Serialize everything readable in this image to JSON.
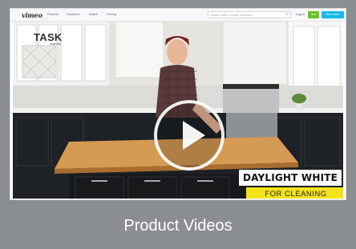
{
  "vimeo": {
    "logo": "vimeo",
    "nav": [
      "Product",
      "Solutions",
      "Watch",
      "Pricing"
    ],
    "search_placeholder": "Search videos, people, and more",
    "login_label": "Log in",
    "join_label": "Join",
    "new_video_label": "New video"
  },
  "video": {
    "brand_logo": "TASK",
    "brand_sub": "cabinetry",
    "overlay_title": "DAYLIGHT WHITE",
    "overlay_subtitle": "FOR CLEANING"
  },
  "caption": "Product Videos",
  "colors": {
    "card_bg": "#8b8e91",
    "join_green": "#6ac02a",
    "new_video_blue": "#1ab7ea",
    "subtitle_yellow": "#f4e21b"
  }
}
